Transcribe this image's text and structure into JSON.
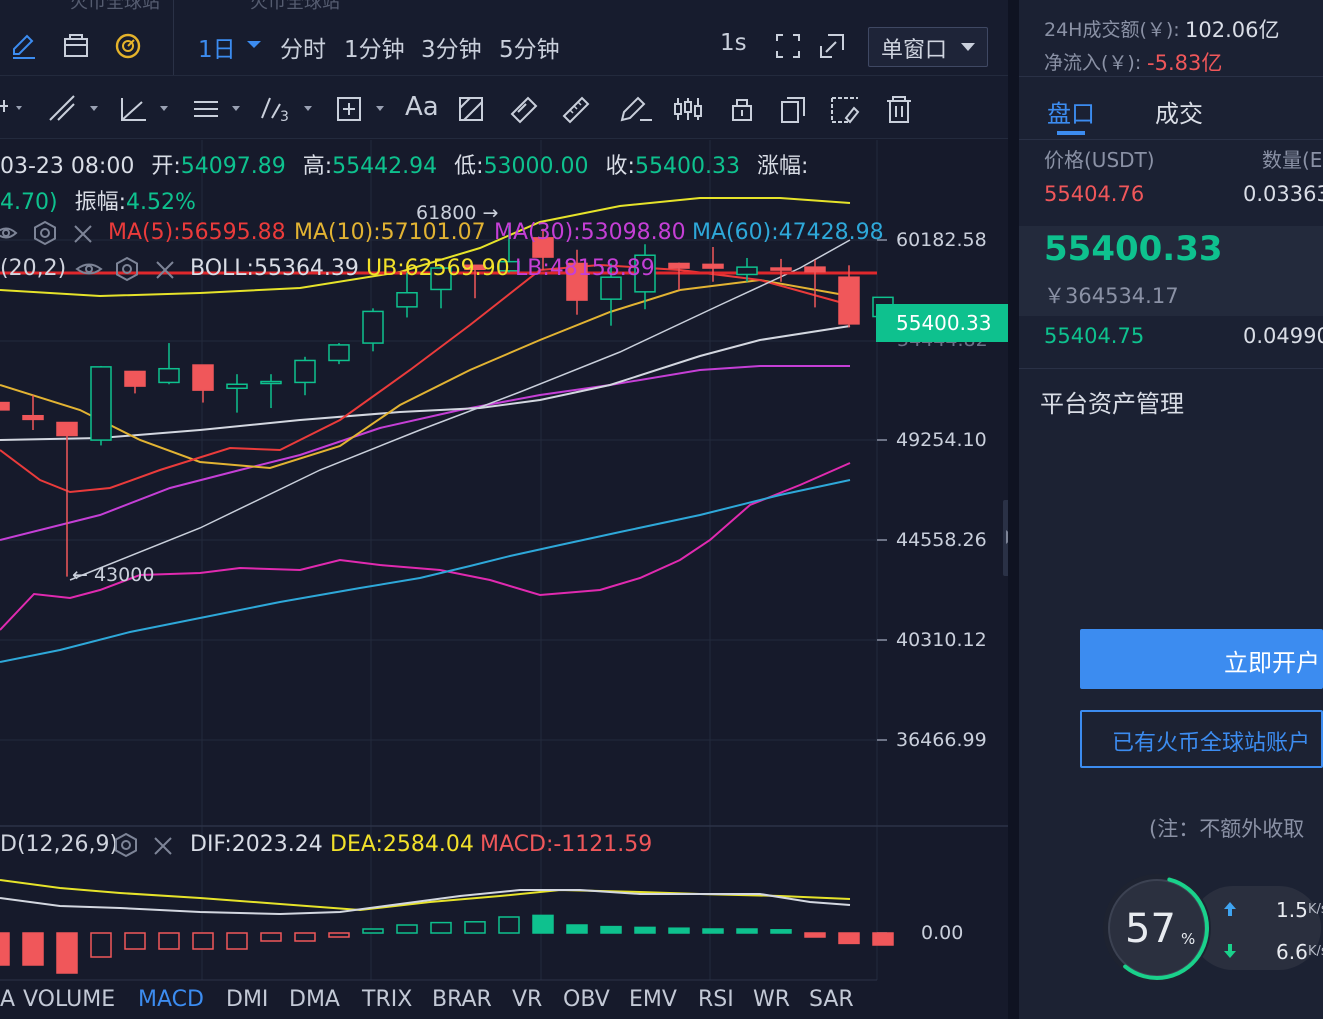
{
  "header": {
    "faded_left": "火币全球站",
    "faded_mid": "火币全球站",
    "period_selected": "1日",
    "periods": [
      "分时",
      "1分钟",
      "3分钟",
      "5分钟"
    ],
    "interval_1s": "1s",
    "window_mode": "单窗口"
  },
  "toolbar": {
    "font_button": "Aa"
  },
  "info": {
    "date": "03-23 08:00",
    "open_label": "开:",
    "open": "54097.89",
    "high_label": "高:",
    "high": "55442.94",
    "low_label": "低:",
    "low": "53000.00",
    "close_label": "收:",
    "close": "55400.33",
    "change_label": "涨幅:",
    "change_cont": "4.70)",
    "amp_label": "振幅:",
    "amp": "4.52%"
  },
  "ma": {
    "ma5": "MA(5):56595.88",
    "ma10": "MA(10):57101.07",
    "ma30": "MA(30):53098.80",
    "ma60": "MA(60):47428.98"
  },
  "boll": {
    "params": "(20,2)",
    "mid": "BOLL:55364.39",
    "ub": "UB:62569.90",
    "lb": "LB:48158.89"
  },
  "markers": {
    "high": "61800 →",
    "low": "← 43000"
  },
  "price_axis": [
    "60182.58",
    "49254.10",
    "44558.26",
    "40310.12",
    "36466.99"
  ],
  "current_price_tag": "55400.33",
  "hidden_price": "54444.82",
  "macd": {
    "params": "D(12,26,9)",
    "dif": "DIF:2023.24",
    "dea": "DEA:2584.04",
    "macd": "MACD:-1121.59",
    "zero": "0.00"
  },
  "indicator_tabs": [
    "A",
    "VOLUME",
    "MACD",
    "DMI",
    "DMA",
    "TRIX",
    "BRAR",
    "VR",
    "OBV",
    "EMV",
    "RSI",
    "WR",
    "SAR"
  ],
  "active_indicator": "MACD",
  "right": {
    "turnover_label": "24H成交额(￥):",
    "turnover": "102.06亿",
    "netflow_label": "净流入(￥):",
    "netflow": "-5.83亿",
    "tab_orderbook": "盘口",
    "tab_trades": "成交",
    "col_price": "价格(USDT)",
    "col_qty": "数量(E",
    "ask_price": "55404.76",
    "ask_qty": "0.03363",
    "last_price": "55400.33",
    "last_cny": "￥364534.17",
    "bid_price": "55404.75",
    "bid_qty": "0.04990",
    "asset_mgmt": "平台资产管理",
    "open_account": "立即开户",
    "have_account": "已有火币全球站账户",
    "note": "(注：不额外收取"
  },
  "speed_widget": {
    "percent": "57",
    "percent_sign": "%",
    "up": "1.5",
    "down": "6.6",
    "unit": "K/s"
  },
  "colors": {
    "up": "#0ec18e",
    "down": "#f0575a",
    "accent": "#3c8cf0",
    "ma5": "#ea3b3b",
    "ma10": "#e2b333",
    "ma30": "#c53fd6",
    "ma60": "#2ea8d9"
  },
  "chart_data": {
    "type": "candlestick",
    "y_ticks": [
      60182.58,
      49254.1,
      44558.26,
      40310.12,
      36466.99
    ],
    "candles": [
      {
        "o": 51300,
        "c": 50900,
        "h": 51300,
        "l": 50900
      },
      {
        "o": 50580,
        "c": 50380,
        "h": 51700,
        "l": 49800
      },
      {
        "o": 50210,
        "c": 49500,
        "h": 50210,
        "l": 43000
      },
      {
        "o": 49250,
        "c": 53250,
        "h": 53300,
        "l": 49000
      },
      {
        "o": 53000,
        "c": 52200,
        "h": 53000,
        "l": 51800
      },
      {
        "o": 52400,
        "c": 53150,
        "h": 54550,
        "l": 52300
      },
      {
        "o": 53350,
        "c": 51980,
        "h": 53350,
        "l": 51300
      },
      {
        "o": 52080,
        "c": 52300,
        "h": 52850,
        "l": 50750
      },
      {
        "o": 52350,
        "c": 52450,
        "h": 52850,
        "l": 51000
      },
      {
        "o": 52400,
        "c": 53600,
        "h": 53800,
        "l": 51700
      },
      {
        "o": 53600,
        "c": 54450,
        "h": 54550,
        "l": 53400
      },
      {
        "o": 54550,
        "c": 56280,
        "h": 56450,
        "l": 54100
      },
      {
        "o": 56530,
        "c": 57300,
        "h": 58400,
        "l": 55950
      },
      {
        "o": 57480,
        "c": 58650,
        "h": 58850,
        "l": 56450
      },
      {
        "o": 58800,
        "c": 58580,
        "h": 58800,
        "l": 57000
      },
      {
        "o": 58500,
        "c": 59000,
        "h": 60950,
        "l": 58400
      },
      {
        "o": 60300,
        "c": 59250,
        "h": 60800,
        "l": 58550
      },
      {
        "o": 58900,
        "c": 56900,
        "h": 59650,
        "l": 56100
      },
      {
        "o": 56950,
        "c": 58150,
        "h": 58900,
        "l": 55500
      },
      {
        "o": 57350,
        "c": 59350,
        "h": 59950,
        "l": 56400
      },
      {
        "o": 58900,
        "c": 58650,
        "h": 58950,
        "l": 57450
      },
      {
        "o": 58850,
        "c": 58650,
        "h": 59800,
        "l": 57900
      },
      {
        "o": 58300,
        "c": 58700,
        "h": 59200,
        "l": 57900
      },
      {
        "o": 58650,
        "c": 58550,
        "h": 59150,
        "l": 57900
      },
      {
        "o": 58700,
        "c": 58450,
        "h": 59100,
        "l": 56500
      },
      {
        "o": 58150,
        "c": 55600,
        "h": 58800,
        "l": 55400
      },
      {
        "o": 56000,
        "c": 57050,
        "h": 57050,
        "l": 55100
      }
    ],
    "macd_bars": [
      -4,
      -4,
      -5,
      -3,
      -2,
      -2,
      -2,
      -2,
      -1,
      -1,
      -0.5,
      0.5,
      1,
      1.3,
      1.4,
      2,
      2.2,
      1,
      0.8,
      0.7,
      0.6,
      0.5,
      0.5,
      0.4,
      -0.5,
      -1.3,
      -1.5
    ]
  }
}
